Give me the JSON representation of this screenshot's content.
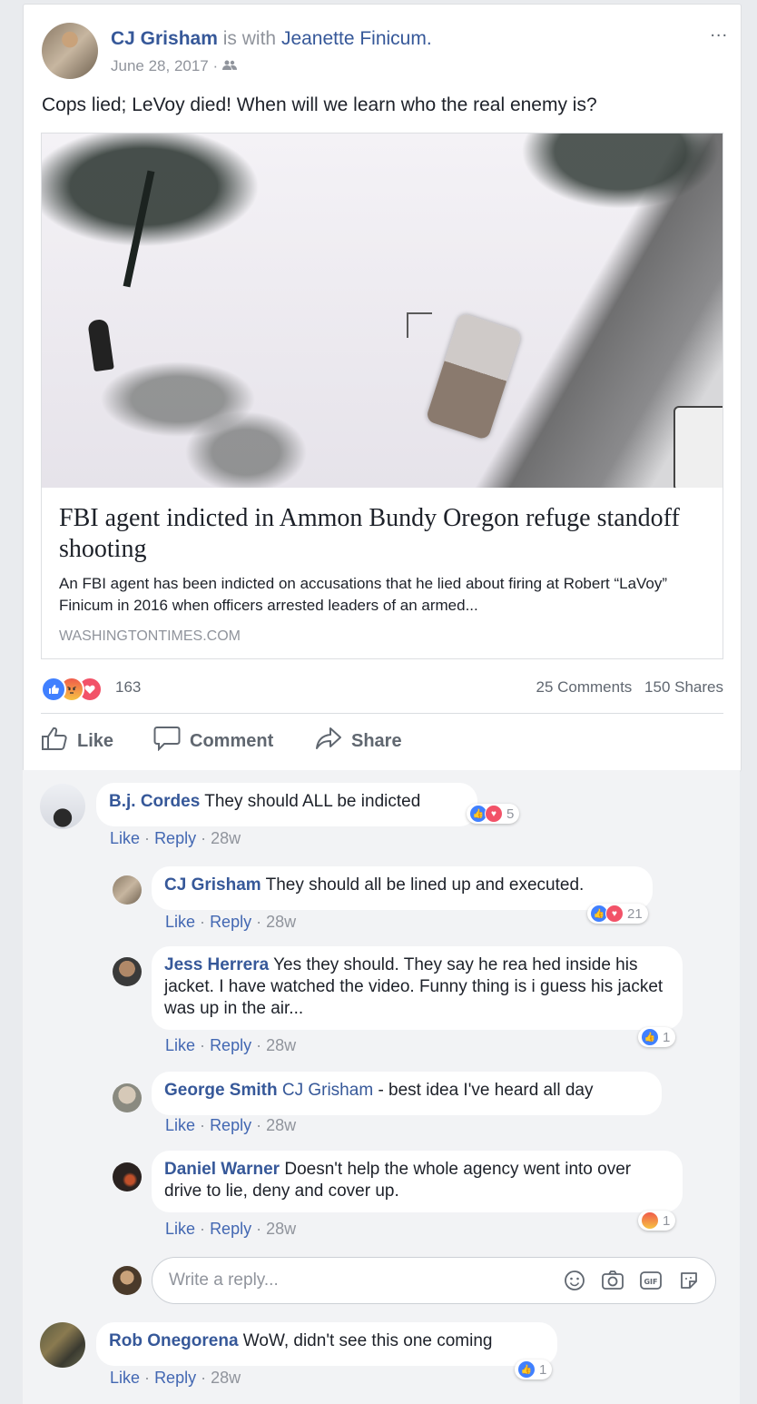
{
  "post": {
    "author": "CJ Grisham",
    "with_text": "is with",
    "tagged": "Jeanette Finicum.",
    "date": "June 28, 2017",
    "menu": "...",
    "text": "Cops lied; LeVoy died! When will we learn who the real enemy is?",
    "link": {
      "title": "FBI agent indicted in Ammon Bundy Oregon refuge standoff shooting",
      "description": "An FBI agent has been indicted on accusations that he lied about firing at Robert “LaVoy” Finicum in 2016 when officers arrested leaders of an armed...",
      "domain": "WASHINGTONTIMES.COM"
    },
    "reaction_count": "163",
    "comments_count": "25 Comments",
    "shares_count": "150 Shares",
    "actions": {
      "like": "Like",
      "comment": "Comment",
      "share": "Share"
    }
  },
  "comment_meta": {
    "like": "Like",
    "reply": "Reply",
    "sep": "·",
    "age": "28w"
  },
  "comments": [
    {
      "name": "B.j. Cordes",
      "text": "They should ALL be indicted",
      "reactions": "5"
    },
    {
      "name": "CJ Grisham",
      "text": "They should all be lined up and executed.",
      "reactions": "21"
    },
    {
      "name": "Jess Herrera",
      "text": "Yes they should. They say he rea hed inside his jacket. I have watched the video. Funny thing is i guess his jacket was up in the air...",
      "reactions": "1"
    },
    {
      "name": "George Smith",
      "mention": "CJ Grisham",
      "text": "- best idea I've heard all day"
    },
    {
      "name": "Daniel Warner",
      "text": "Doesn't help the whole agency went into over drive to lie, deny and cover up.",
      "reactions": "1"
    },
    {
      "name": "Rob Onegorena",
      "text": "WoW, didn't see this one coming",
      "reactions": "1"
    }
  ],
  "reply_box": {
    "placeholder": "Write a reply..."
  },
  "icons": [
    "friends-icon",
    "like-icon",
    "comment-icon",
    "share-icon",
    "emoji-icon",
    "camera-icon",
    "gif-icon",
    "sticker-icon"
  ]
}
